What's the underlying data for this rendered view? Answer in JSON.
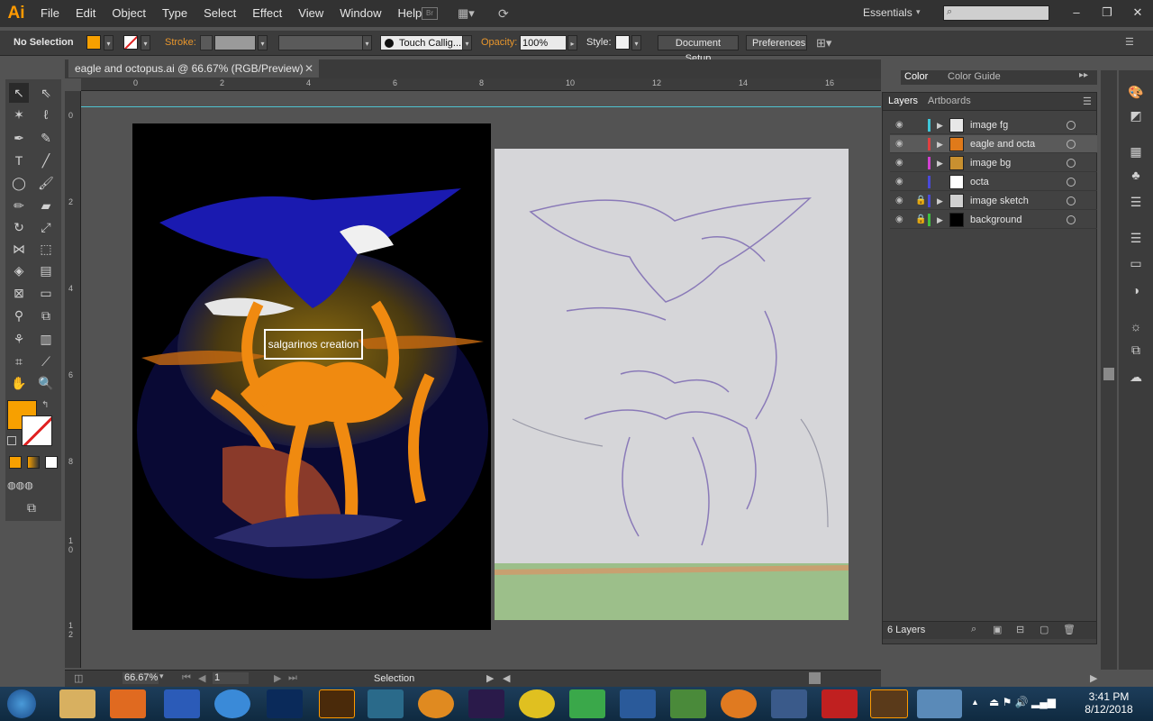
{
  "menubar": {
    "logo": "Ai",
    "items": [
      "File",
      "Edit",
      "Object",
      "Type",
      "Select",
      "Effect",
      "View",
      "Window",
      "Help"
    ],
    "workspace": "Essentials",
    "window_controls": [
      "–",
      "❐",
      "✕"
    ]
  },
  "control_bar": {
    "selection_label": "No Selection",
    "stroke_label": "Stroke:",
    "brush": "Touch Callig...",
    "opacity_label": "Opacity:",
    "opacity_value": "100%",
    "style_label": "Style:",
    "document_setup": "Document Setup",
    "preferences": "Preferences"
  },
  "document": {
    "tab_title": "eagle and octopus.ai @ 66.67% (RGB/Preview)",
    "label_text": "salgarinos creation",
    "ruler_h": [
      "0",
      "2",
      "4",
      "6",
      "8",
      "10",
      "12",
      "14",
      "16"
    ],
    "ruler_v": [
      "0",
      "2",
      "4",
      "6",
      "8",
      "1 0",
      "1 2"
    ]
  },
  "color_panel": {
    "tabs": [
      "Color",
      "Color Guide"
    ]
  },
  "layers_panel": {
    "tabs": [
      "Layers",
      "Artboards"
    ],
    "layers": [
      {
        "name": "image fg",
        "color": "#3ec6d8",
        "locked": false,
        "thumb": "#e8e8e8"
      },
      {
        "name": "eagle and octa",
        "color": "#e04040",
        "locked": false,
        "thumb": "#e07a1a",
        "selected": true
      },
      {
        "name": "image bg",
        "color": "#d040d0",
        "locked": false,
        "thumb": "#c89030"
      },
      {
        "name": "octa",
        "color": "#4a4ad8",
        "locked": false,
        "thumb": "#ffffff"
      },
      {
        "name": "image sketch",
        "color": "#4a4ad8",
        "locked": true,
        "thumb": "#cfcfcf"
      },
      {
        "name": "background",
        "color": "#40c040",
        "locked": true,
        "thumb": "#000000"
      }
    ],
    "count": "6 Layers"
  },
  "status": {
    "zoom": "66.67%",
    "artboard": "1",
    "tool": "Selection"
  },
  "taskbar": {
    "time": "3:41 PM",
    "date": "8/12/2018"
  }
}
